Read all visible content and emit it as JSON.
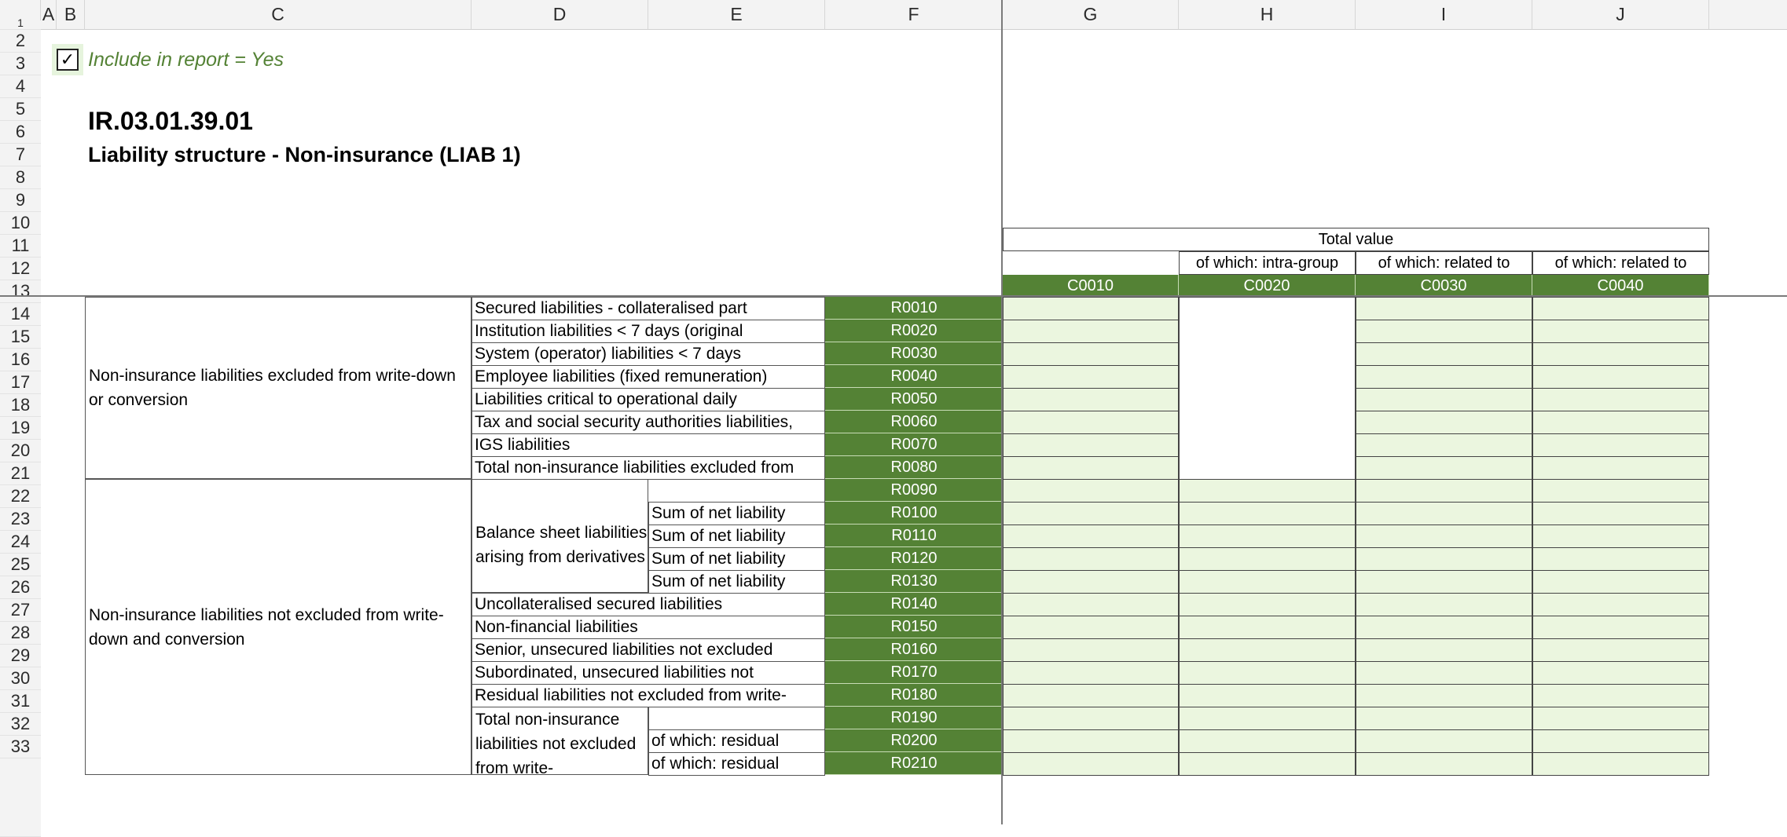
{
  "columns": [
    "A",
    "B",
    "C",
    "D",
    "E",
    "F",
    "G",
    "H",
    "I",
    "J"
  ],
  "rows": [
    "1",
    "2",
    "3",
    "4",
    "5",
    "6",
    "7",
    "8",
    "9",
    "10",
    "11",
    "12",
    "13",
    "14",
    "15",
    "16",
    "17",
    "18",
    "19",
    "20",
    "21",
    "22",
    "23",
    "24",
    "25",
    "26",
    "27",
    "28",
    "29",
    "30",
    "31",
    "32",
    "33"
  ],
  "checkbox": {
    "mark": "✓",
    "label": "Include in report = Yes"
  },
  "template_code": "IR.03.01.39.01",
  "template_title": "Liability structure - Non-insurance (LIAB 1)",
  "header": {
    "total_value": "Total value",
    "sub": [
      "of which: intra-group",
      "of which: related to",
      "of which: related to"
    ],
    "codes": [
      "C0010",
      "C0020",
      "C0030",
      "C0040"
    ]
  },
  "groups": {
    "excluded": "Non-insurance liabilities excluded from write-down or conversion",
    "not_excluded": "Non-insurance liabilities not excluded from write-down and conversion",
    "derivatives": "Balance sheet liabilities arising from derivatives",
    "total_not_excluded": "Total non-insurance liabilities not excluded from write-"
  },
  "lines": [
    {
      "label": "Secured liabilities - collateralised part",
      "code": "R0010"
    },
    {
      "label": "Institution liabilities < 7 days (original",
      "code": "R0020"
    },
    {
      "label": "System (operator) liabilities < 7 days",
      "code": "R0030"
    },
    {
      "label": "Employee liabilities (fixed remuneration)",
      "code": "R0040"
    },
    {
      "label": "Liabilities critical to operational daily",
      "code": "R0050"
    },
    {
      "label": "Tax and social security authorities liabilities,",
      "code": "R0060"
    },
    {
      "label": "IGS liabilities",
      "code": "R0070"
    },
    {
      "label": "Total non-insurance liabilities excluded from",
      "code": "R0080"
    },
    {
      "label": "",
      "code": "R0090"
    },
    {
      "label": "Sum of net liability",
      "code": "R0100"
    },
    {
      "label": "Sum of net liability",
      "code": "R0110"
    },
    {
      "label": "Sum of net liability",
      "code": "R0120"
    },
    {
      "label": "Sum of net liability",
      "code": "R0130"
    },
    {
      "label": "Uncollateralised secured liabilities",
      "code": "R0140"
    },
    {
      "label": "Non-financial liabilities",
      "code": "R0150"
    },
    {
      "label": "Senior, unsecured liabilities not excluded",
      "code": "R0160"
    },
    {
      "label": "Subordinated, unsecured liabilities not",
      "code": "R0170"
    },
    {
      "label": "Residual liabilities not excluded from write-",
      "code": "R0180"
    },
    {
      "label": "",
      "code": "R0190"
    },
    {
      "label": "of which: residual",
      "code": "R0200"
    },
    {
      "label": "of which: residual",
      "code": "R0210"
    }
  ]
}
